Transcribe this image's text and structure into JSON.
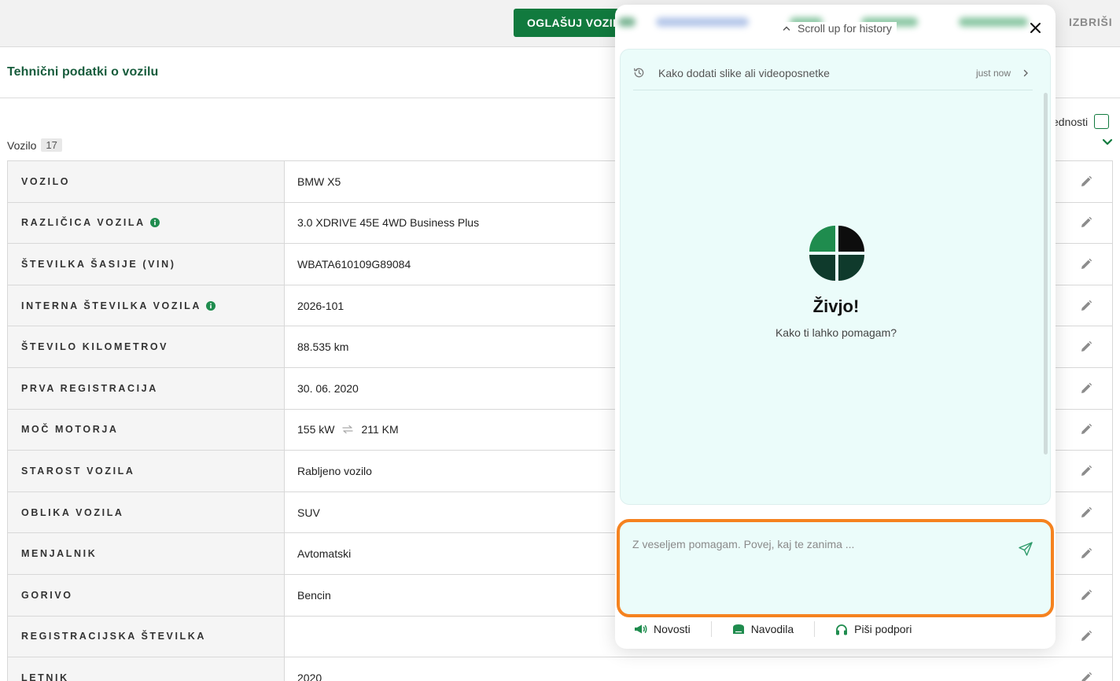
{
  "topbar": {
    "advertise_label": "OGLAŠUJ VOZIL",
    "delete_label": "IZBRIŠI"
  },
  "section": {
    "title": "Tehnični podatki o vozilu",
    "group_label": "Vozilo",
    "group_count": "17",
    "values_toggle_label": "ednosti"
  },
  "specs": [
    {
      "label": "VOZILO",
      "value": "BMW X5",
      "info": false
    },
    {
      "label": "RAZLIČICA VOZILA",
      "value": "3.0 XDRIVE 45E 4WD Business Plus",
      "info": true
    },
    {
      "label": "ŠTEVILKA ŠASIJE (VIN)",
      "value": "WBATA610109G89084",
      "info": false
    },
    {
      "label": "INTERNA ŠTEVILKA VOZILA",
      "value": "2026-101",
      "info": true
    },
    {
      "label": "ŠTEVILO KILOMETROV",
      "value": "88.535 km",
      "info": false
    },
    {
      "label": "PRVA REGISTRACIJA",
      "value": "30. 06. 2020",
      "info": false
    },
    {
      "label": "MOČ MOTORJA",
      "value": "155 kW",
      "value2": "211 KM",
      "info": false
    },
    {
      "label": "STAROST VOZILA",
      "value": "Rabljeno vozilo",
      "info": false
    },
    {
      "label": "OBLIKA VOZILA",
      "value": "SUV",
      "info": false
    },
    {
      "label": "MENJALNIK",
      "value": "Avtomatski",
      "info": false
    },
    {
      "label": "GORIVO",
      "value": "Bencin",
      "info": false
    },
    {
      "label": "REGISTRACIJSKA ŠTEVILKA",
      "value": "",
      "info": false
    },
    {
      "label": "LETNIK",
      "value": "2020",
      "info": false
    }
  ],
  "chat": {
    "scroll_hint": "Scroll up for history",
    "history_title": "Kako dodati slike ali videoposnetke",
    "history_time": "just now",
    "greeting": "Živjo!",
    "subtitle": "Kako ti lahko pomagam?",
    "input_placeholder": "Z veseljem pomagam. Povej, kaj te zanima ...",
    "footer": {
      "news": "Novosti",
      "guides": "Navodila",
      "support": "Piši podpori"
    }
  },
  "colors": {
    "brand_green": "#117a3e",
    "highlight_orange": "#f5821f",
    "chat_bg": "#ebfcfa"
  },
  "icons": [
    "info-icon",
    "edit-icon",
    "swap-icon",
    "history-icon",
    "chevron-right-icon",
    "chevron-up-icon",
    "close-icon",
    "send-icon",
    "megaphone-icon",
    "book-icon",
    "headset-icon",
    "chevron-down-icon",
    "brand-logo"
  ]
}
